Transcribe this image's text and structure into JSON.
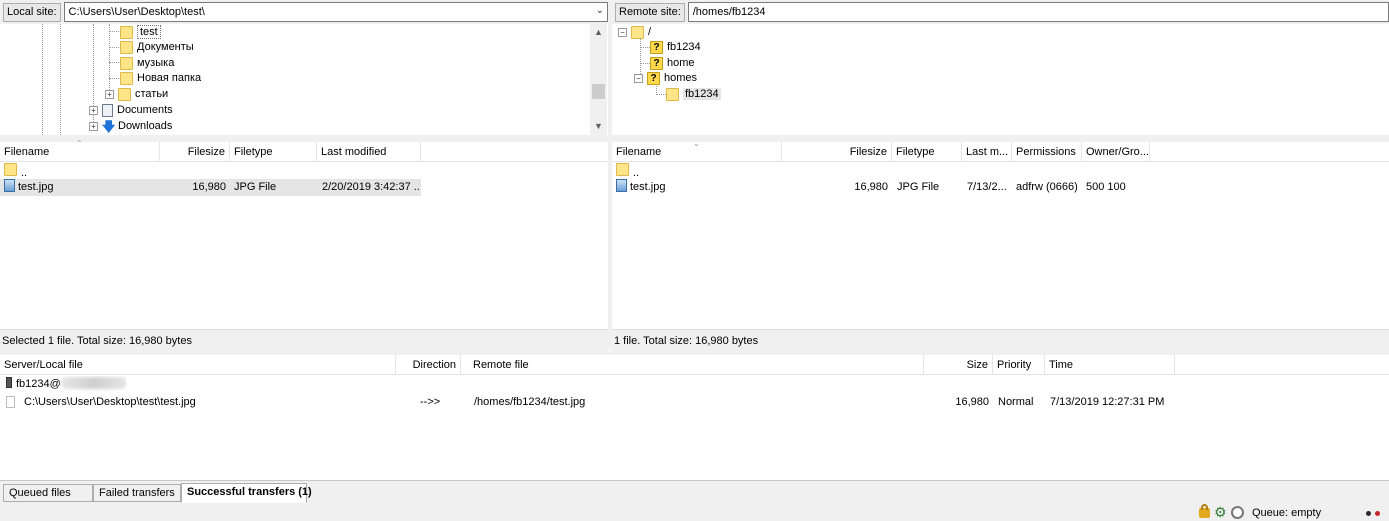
{
  "local": {
    "site_label": "Local site:",
    "path": "C:\\Users\\User\\Desktop\\test\\",
    "tree": [
      "test",
      "Документы",
      "музыка",
      "Новая папка",
      "статьи",
      "Documents",
      "Downloads"
    ],
    "columns": [
      "Filename",
      "Filesize",
      "Filetype",
      "Last modified"
    ],
    "files": [
      {
        "name": "..",
        "size": "",
        "type": "",
        "modified": ""
      },
      {
        "name": "test.jpg",
        "size": "16,980",
        "type": "JPG File",
        "modified": "2/20/2019 3:42:37 ..."
      }
    ],
    "status": "Selected 1 file. Total size: 16,980 bytes"
  },
  "remote": {
    "site_label": "Remote site:",
    "path": "/homes/fb1234",
    "tree": [
      "/",
      "fb1234",
      "home",
      "homes",
      "fb1234"
    ],
    "columns": [
      "Filename",
      "Filesize",
      "Filetype",
      "Last m...",
      "Permissions",
      "Owner/Gro..."
    ],
    "files": [
      {
        "name": "..",
        "size": "",
        "type": "",
        "modified": "",
        "perms": "",
        "owner": ""
      },
      {
        "name": "test.jpg",
        "size": "16,980",
        "type": "JPG File",
        "modified": "7/13/2...",
        "perms": "adfrw (0666)",
        "owner": "500 100"
      }
    ],
    "status": "1 file. Total size: 16,980 bytes"
  },
  "queue": {
    "columns": [
      "Server/Local file",
      "Direction",
      "Remote file",
      "Size",
      "Priority",
      "Time"
    ],
    "server": "fb1234@",
    "item": {
      "local_file": "C:\\Users\\User\\Desktop\\test\\test.jpg",
      "direction": "-->>",
      "remote_file": "/homes/fb1234/test.jpg",
      "size": "16,980",
      "priority": "Normal",
      "time": "7/13/2019 12:27:31 PM"
    }
  },
  "tabs": [
    "Queued files",
    "Failed transfers",
    "Successful transfers (1)"
  ],
  "statusbar": {
    "queue": "Queue: empty"
  },
  "icons": [
    "folder-icon",
    "unknown-folder-icon",
    "file-icon",
    "lock-icon",
    "gear-icon",
    "speed-icon",
    "server-icon",
    "download-icon",
    "documents-icon"
  ],
  "colors": {
    "selection": "#e5e5e5",
    "folder": "#ffe58a",
    "panel_bg": "#f0f0f0"
  }
}
